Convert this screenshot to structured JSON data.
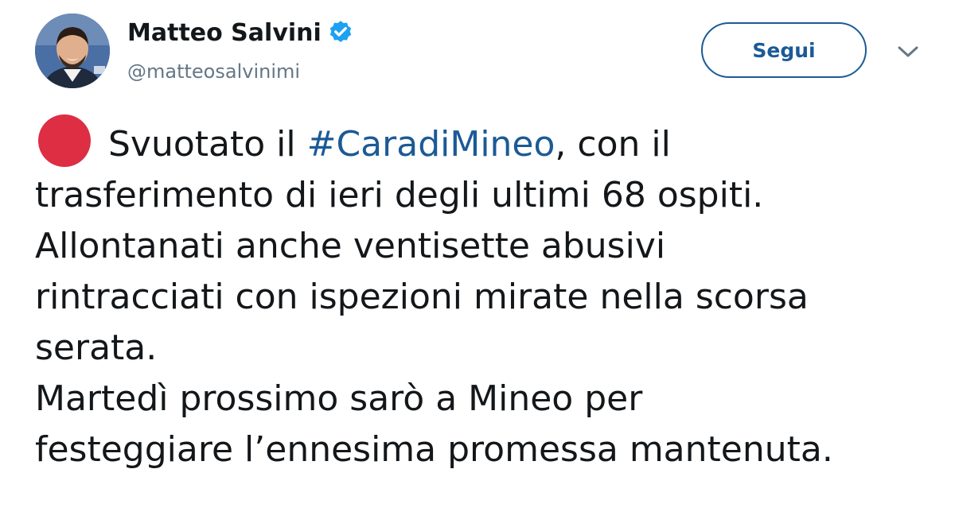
{
  "user": {
    "display_name": "Matteo Salvini",
    "handle": "@matteosalvinimi",
    "verified": true
  },
  "actions": {
    "follow_label": "Segui"
  },
  "tweet": {
    "line1_before": "Svuotato il ",
    "hashtag": "#CaradiMineo",
    "line1_after": ", con il",
    "line2": "trasferimento di ieri degli ultimi 68 ospiti.",
    "line3": "Allontanati anche  ventisette abusivi",
    "line4": "rintracciati con ispezioni mirate nella scorsa",
    "line5": "serata.",
    "line6": "Martedì prossimo sarò a Mineo per",
    "line7": "festeggiare l’ennesima promessa mantenuta."
  },
  "icons": {
    "verified": "verified-badge-icon",
    "emoji": "red-circle-emoji",
    "menu": "chevron-down-icon"
  },
  "colors": {
    "accent": "#1b5a96",
    "verified": "#1da1f2",
    "red_circle": "#dd2e44",
    "secondary_text": "#657786",
    "text": "#14171a"
  }
}
